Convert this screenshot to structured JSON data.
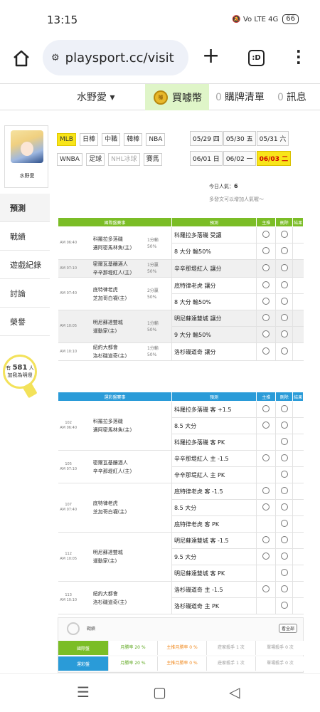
{
  "status": {
    "time": "13:15",
    "signal_icons": "🔕 Vo LTE 4G",
    "battery": "66"
  },
  "browser": {
    "url": "playsport.cc/visit",
    "tabs_icon": ":D"
  },
  "topnav": {
    "user": "水野愛 ▾",
    "buy_label": "買噱幣",
    "coin_icon": "噱",
    "list_count": "0",
    "list_label": "購牌清單",
    "msg_count": "0",
    "msg_label": "訊息"
  },
  "sidebar": {
    "avatar_name": "水野愛",
    "items": [
      "預測",
      "戰績",
      "遊戲紀錄",
      "討論",
      "榮譽"
    ],
    "bulb_prefix": "有",
    "bulb_count": "581",
    "bulb_suffix": "人",
    "bulb_sub": "加我為明燈"
  },
  "leagues": [
    {
      "label": "MLB",
      "state": "active"
    },
    {
      "label": "日棒",
      "state": "normal"
    },
    {
      "label": "中職",
      "state": "normal"
    },
    {
      "label": "韓棒",
      "state": "normal"
    },
    {
      "label": "NBA",
      "state": "normal"
    },
    {
      "label": "WNBA",
      "state": "normal"
    },
    {
      "label": "足球",
      "state": "normal"
    },
    {
      "label": "NHL冰球",
      "state": "dim"
    },
    {
      "label": "賽馬",
      "state": "normal"
    }
  ],
  "dates": [
    {
      "label": "05/29 四",
      "state": "normal"
    },
    {
      "label": "05/30 五",
      "state": "normal"
    },
    {
      "label": "05/31 六",
      "state": "normal"
    },
    {
      "label": "06/01 日",
      "state": "normal"
    },
    {
      "label": "06/02 一",
      "state": "normal"
    },
    {
      "label": "06/03 二",
      "state": "active"
    }
  ],
  "popular": {
    "label": "今日人氣：",
    "value": "6"
  },
  "hint": "多發文可以增加人氣喔～",
  "table_headers": {
    "event_intl": "國際盤賽事",
    "event_local": "運彩盤賽事",
    "pick": "預測",
    "main": "主推",
    "cancel": "刪除",
    "result": "結果"
  },
  "intl_rows": [
    {
      "time": "AM 06:40",
      "home": "科羅拉多落磯",
      "away": "邁阿密馬林魚(主)",
      "odds": "1分輸\n50%",
      "picks": [
        "科羅拉多落磯 受讓",
        "8 大分 輸50%"
      ]
    },
    {
      "time": "AM 07:10",
      "home": "密爾瓦基釀酒人",
      "away": "辛辛那堤紅人(主)",
      "odds": "1分贏\n50%",
      "picks": [
        "辛辛那堤紅人 讓分"
      ]
    },
    {
      "time": "AM 07:40",
      "home": "底特律老虎",
      "away": "芝加哥白襪(主)",
      "odds": "2分贏\n50%",
      "picks": [
        "底特律老虎 讓分",
        "8 大分 輸50%"
      ]
    },
    {
      "time": "AM 10:05",
      "home": "明尼蘇達雙城",
      "away": "運動家(主)",
      "odds": "1分輸\n50%",
      "picks": [
        "明尼蘇達雙城 讓分",
        "9 大分 輸50%"
      ]
    },
    {
      "time": "AM 10:10",
      "home": "紐約大都會",
      "away": "洛杉磯道奇(主)",
      "odds": "1分輸\n50%",
      "picks": [
        "洛杉磯道奇 讓分"
      ]
    }
  ],
  "local_rows": [
    {
      "no": "102",
      "time": "AM 06:40",
      "home": "科羅拉多落磯",
      "away": "邁阿密馬林魚(主)",
      "picks": [
        "科羅拉多落磯 客 +1.5",
        "8.5 大分",
        "科羅拉多落磯 客 PK"
      ]
    },
    {
      "no": "105",
      "time": "AM 07:10",
      "home": "密爾瓦基釀酒人",
      "away": "辛辛那堤紅人(主)",
      "picks": [
        "辛辛那堤紅人 主 -1.5",
        "辛辛那堤紅人 主 PK"
      ]
    },
    {
      "no": "107",
      "time": "AM 07:40",
      "home": "底特律老虎",
      "away": "芝加哥白襪(主)",
      "picks": [
        "底特律老虎 客 -1.5",
        "8.5 大分",
        "底特律老虎 客 PK"
      ]
    },
    {
      "no": "112",
      "time": "AM 10:05",
      "home": "明尼蘇達雙城",
      "away": "運動家(主)",
      "picks": [
        "明尼蘇達雙城 客 -1.5",
        "9.5 大分",
        "明尼蘇達雙城 客 PK"
      ]
    },
    {
      "no": "113",
      "time": "AM 10:10",
      "home": "紐約大都會",
      "away": "洛杉磯道奇(主)",
      "picks": [
        "洛杉磯道奇 主 -1.5",
        "洛杉磯道奇 主 PK"
      ]
    }
  ],
  "stats": {
    "title": "戰績",
    "view_all": "看全部",
    "rows": [
      {
        "label": "國際盤",
        "color": "#7bbd26",
        "cells": [
          "月勝率 20 %",
          "主推月勝率 0 %",
          "莊家殺手 1 次",
          "單場殺手 0 次"
        ]
      },
      {
        "label": "運彩盤",
        "color": "#2a9bd8",
        "cells": [
          "月勝率 20 %",
          "主推月勝率 0 %",
          "莊家殺手 1 次",
          "單場殺手 0 次"
        ]
      }
    ]
  },
  "navbar": {
    "recent": "☰",
    "home": "▢",
    "back": "◁"
  }
}
